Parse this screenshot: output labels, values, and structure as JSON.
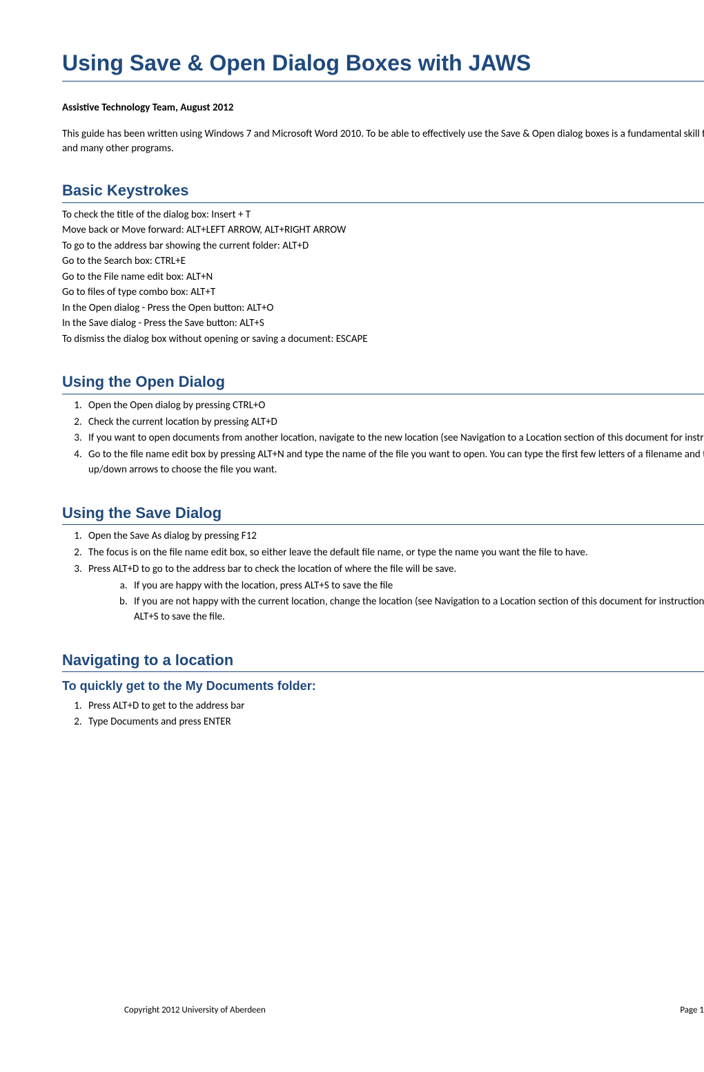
{
  "title": "Using Save & Open Dialog Boxes with JAWS",
  "byline": "Assistive Technology Team, August 2012",
  "intro": "This guide has been written using Windows 7 and Microsoft Word 2010. To be able to effectively use the Save & Open dialog boxes is a fundamental skill for using Word and many other programs.",
  "sections": {
    "basic": {
      "heading": "Basic Keystrokes",
      "lines": [
        "To check the title of the dialog box: Insert + T",
        "Move back or Move forward: ALT+LEFT ARROW, ALT+RIGHT ARROW",
        "To go to the address bar showing the current folder: ALT+D",
        "Go to the Search box: CTRL+E",
        "Go to the File name edit box: ALT+N",
        "Go to files of type combo box: ALT+T",
        "In the Open dialog - Press the Open button:  ALT+O",
        "In the Save dialog - Press the Save button: ALT+S",
        "To dismiss the dialog box without opening or saving a document: ESCAPE"
      ]
    },
    "open": {
      "heading": "Using the Open Dialog",
      "items": [
        "Open the Open dialog by pressing CTRL+O",
        "Check the current location by pressing ALT+D",
        "If you want to open documents from another location, navigate to the new location (see Navigation to a Location section of this document for instructions)",
        "Go to the file name edit box by pressing ALT+N and type the name of the file you want to open. You can type the first few letters of a filename and then use the up/down arrows to choose the file you want."
      ]
    },
    "save": {
      "heading": "Using the Save Dialog",
      "items": [
        "Open the Save As dialog by pressing F12",
        "The focus is on the file name edit box, so either leave the default file name, or type the name you want the file to have.",
        "Press ALT+D to go to the address bar to check the location of where the file will be save."
      ],
      "subitems": [
        "If you are happy with the location, press ALT+S to save the file",
        "If you are not happy with the current location, change the location (see Navigation to a Location section of this document for instructions), then press ALT+S to save the file."
      ]
    },
    "nav": {
      "heading": "Navigating to a location",
      "sub": {
        "heading": "To quickly get to the My Documents folder:",
        "items": [
          "Press ALT+D to get to the address bar",
          "Type Documents and press ENTER"
        ]
      }
    }
  },
  "footer": {
    "copyright": "Copyright 2012 University of Aberdeen",
    "page": "Page 1"
  }
}
